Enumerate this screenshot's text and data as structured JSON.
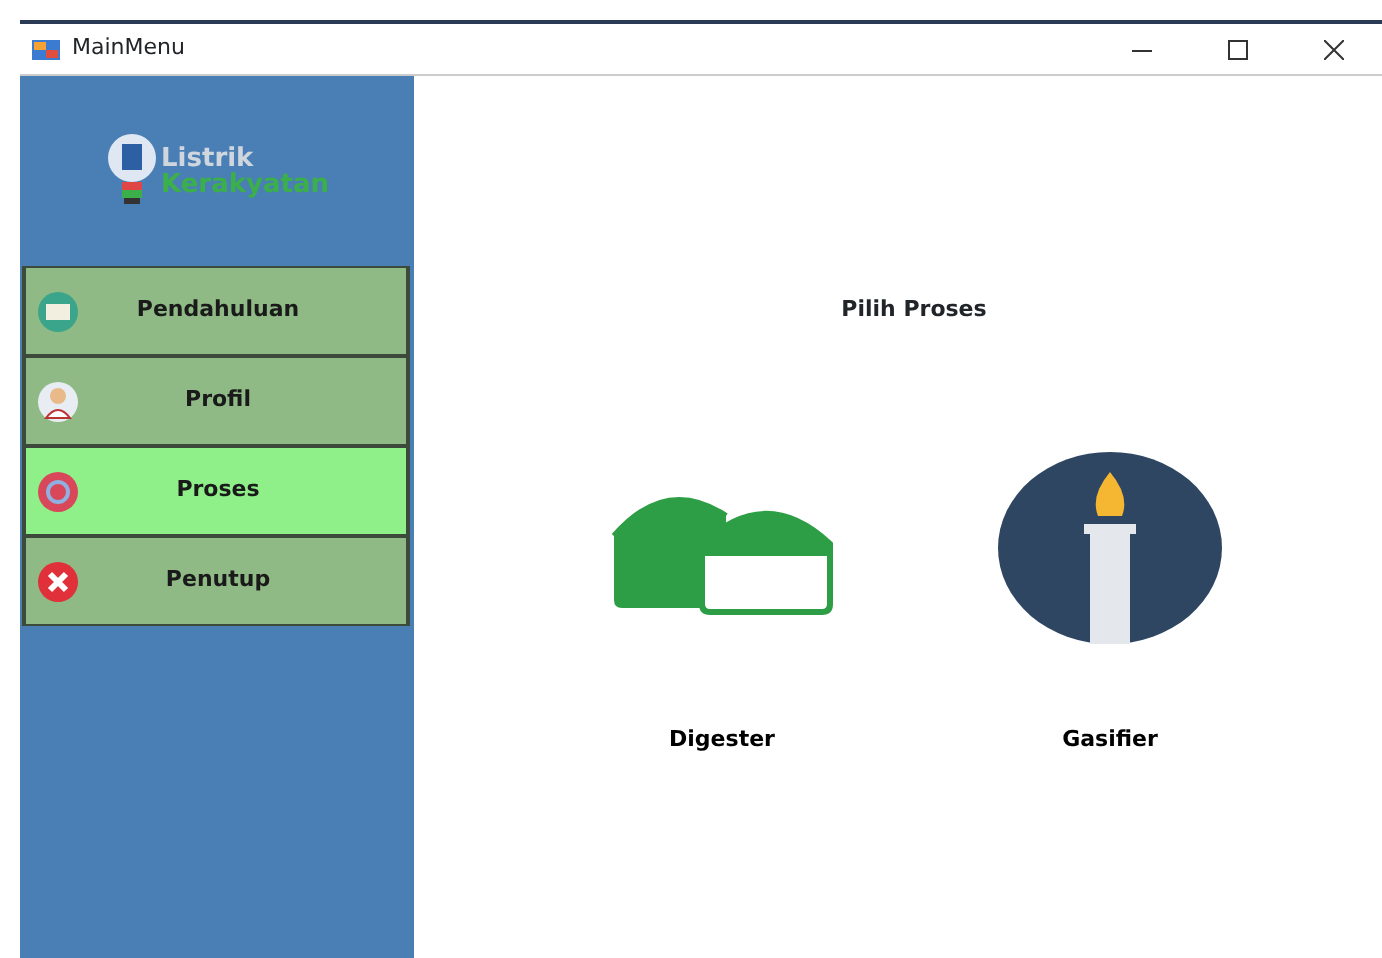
{
  "window": {
    "title": "MainMenu"
  },
  "logo": {
    "line1": "Listrik",
    "line2": "Kerakyatan"
  },
  "sidebar": {
    "items": [
      {
        "label": "Pendahuluan",
        "kind": "book",
        "selected": false
      },
      {
        "label": "Profil",
        "kind": "person",
        "selected": false
      },
      {
        "label": "Proses",
        "kind": "gear",
        "selected": true
      },
      {
        "label": "Penutup",
        "kind": "close",
        "selected": false
      }
    ]
  },
  "main": {
    "heading": "Pilih Proses",
    "options": [
      {
        "label": "Digester",
        "kind": "digester"
      },
      {
        "label": "Gasifier",
        "kind": "gasifier"
      }
    ]
  }
}
